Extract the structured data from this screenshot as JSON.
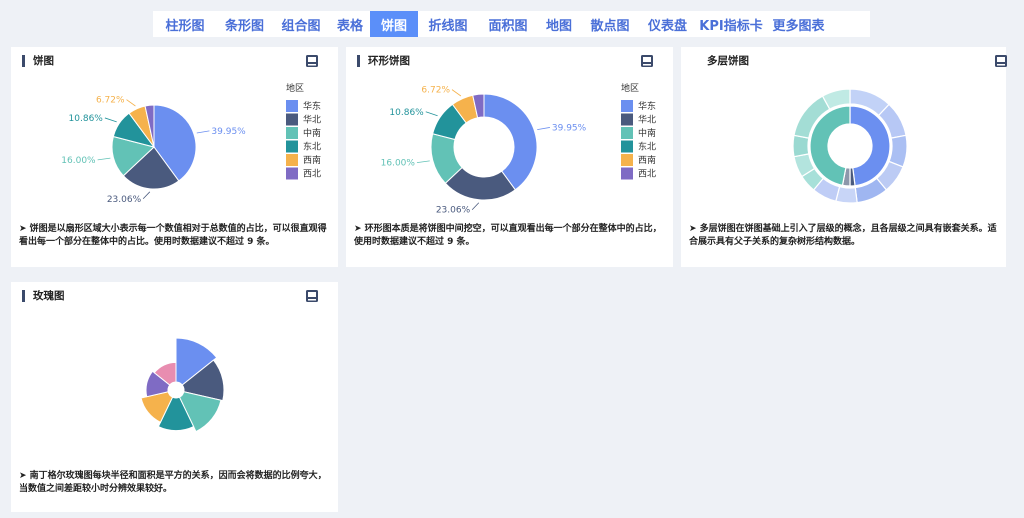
{
  "tabs": [
    {
      "label": "柱形图",
      "active": false
    },
    {
      "label": "条形图",
      "active": false
    },
    {
      "label": "组合图",
      "active": false
    },
    {
      "label": "表格",
      "active": false
    },
    {
      "label": "饼图",
      "active": true
    },
    {
      "label": "折线图",
      "active": false
    },
    {
      "label": "面积图",
      "active": false
    },
    {
      "label": "地图",
      "active": false
    },
    {
      "label": "散点图",
      "active": false
    },
    {
      "label": "仪表盘",
      "active": false
    },
    {
      "label": "KPI指标卡",
      "active": false
    },
    {
      "label": "更多图表",
      "active": false
    }
  ],
  "cards": {
    "pie": {
      "title": "饼图",
      "description": "➤ 饼图是以扇形区域大小表示每一个数值相对于总数值的占比，可以很直观得看出每一个部分在整体中的占比。使用时数据建议不超过 9 条。"
    },
    "donut": {
      "title": "环形饼图",
      "description": "➤ 环形图本质是将饼图中间挖空，可以直观看出每一个部分在整体中的占比，使用时数据建议不超过 9 条。"
    },
    "multi": {
      "title": "多层饼图",
      "description": "➤ 多层饼图在饼图基础上引入了层级的概念，且各层级之间具有嵌套关系。适合展示具有父子关系的复杂树形结构数据。"
    },
    "rose": {
      "title": "玫瑰图",
      "description": "➤ 南丁格尔玫瑰图每块半径和面积是平方的关系，因而会将数据的比例夸大，当数值之间差距较小时分辨效果较好。"
    }
  },
  "chart_data": [
    {
      "type": "pie",
      "legend_title": "地区",
      "legend_position": "right",
      "categories": [
        "华东",
        "华北",
        "中南",
        "东北",
        "西南",
        "西北"
      ],
      "colors": [
        "#6b8ff0",
        "#4a5a7e",
        "#62c2b6",
        "#22939b",
        "#f5b24c",
        "#7f6bc4"
      ],
      "values": [
        39.95,
        23.06,
        16.0,
        10.86,
        6.72,
        3.41
      ],
      "labels": [
        "39.95%",
        "23.06%",
        "16.00%",
        "10.86%",
        "6.72%"
      ]
    },
    {
      "type": "pie",
      "subtype": "donut",
      "legend_title": "地区",
      "legend_position": "right",
      "categories": [
        "华东",
        "华北",
        "中南",
        "东北",
        "西南",
        "西北"
      ],
      "colors": [
        "#6b8ff0",
        "#4a5a7e",
        "#62c2b6",
        "#22939b",
        "#f5b24c",
        "#7f6bc4"
      ],
      "values": [
        39.95,
        23.06,
        16.0,
        10.86,
        6.72,
        3.41
      ],
      "labels": [
        "39.95%",
        "23.06%",
        "16.00%",
        "10.86%",
        "6.72%"
      ]
    },
    {
      "type": "pie",
      "subtype": "multi-level",
      "inner": {
        "values": [
          48,
          2,
          3,
          47
        ],
        "colors": [
          "#6b8ff0",
          "#4a5a7e",
          "#8d97ab",
          "#62c2b6"
        ]
      },
      "outer": {
        "values": [
          12,
          10,
          9,
          8,
          9,
          6,
          7,
          5,
          6,
          6,
          14,
          8
        ],
        "colors": [
          "#c2d2f7",
          "#b7c8f5",
          "#aabff3",
          "#bccbf4",
          "#9fb6f1",
          "#c8d5f7",
          "#bfcdf6",
          "#a7e0d9",
          "#b3e4de",
          "#9ad9d1",
          "#a3ddd5",
          "#c0eae4"
        ]
      }
    },
    {
      "type": "pie",
      "subtype": "rose",
      "values": [
        40,
        33,
        30,
        22,
        16,
        10,
        8
      ],
      "colors": [
        "#6b8ff0",
        "#4a5a7e",
        "#62c2b6",
        "#22939b",
        "#f5b24c",
        "#7f6bc4",
        "#e88db0"
      ]
    }
  ]
}
